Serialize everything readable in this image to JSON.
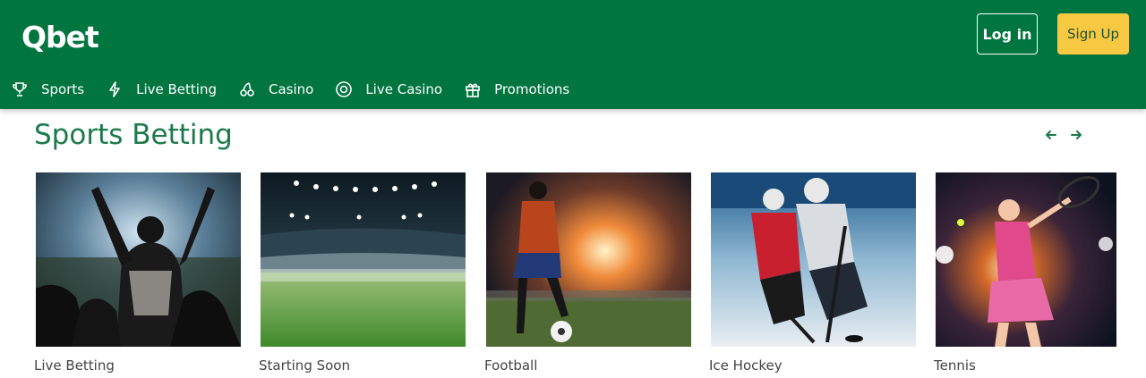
{
  "header": {
    "logo_text": "Qbet",
    "login_label": "Log in",
    "signup_label": "Sign Up",
    "brand_color": "#00753f",
    "signup_color": "#f7c943"
  },
  "nav": {
    "items": [
      {
        "label": "Sports",
        "icon": "trophy-icon"
      },
      {
        "label": "Live Betting",
        "icon": "lightning-icon"
      },
      {
        "label": "Casino",
        "icon": "cherries-icon"
      },
      {
        "label": "Live Casino",
        "icon": "chip-icon"
      },
      {
        "label": "Promotions",
        "icon": "gift-icon"
      }
    ]
  },
  "section": {
    "title": "Sports Betting",
    "prev_icon": "arrow-left-icon",
    "next_icon": "arrow-right-icon"
  },
  "cards": [
    {
      "label": "Live Betting",
      "image": "stadium-crowd-photo"
    },
    {
      "label": "Starting Soon",
      "image": "empty-stadium-photo"
    },
    {
      "label": "Football",
      "image": "football-player-photo"
    },
    {
      "label": "Ice Hockey",
      "image": "ice-hockey-photo"
    },
    {
      "label": "Tennis",
      "image": "tennis-player-photo"
    }
  ]
}
